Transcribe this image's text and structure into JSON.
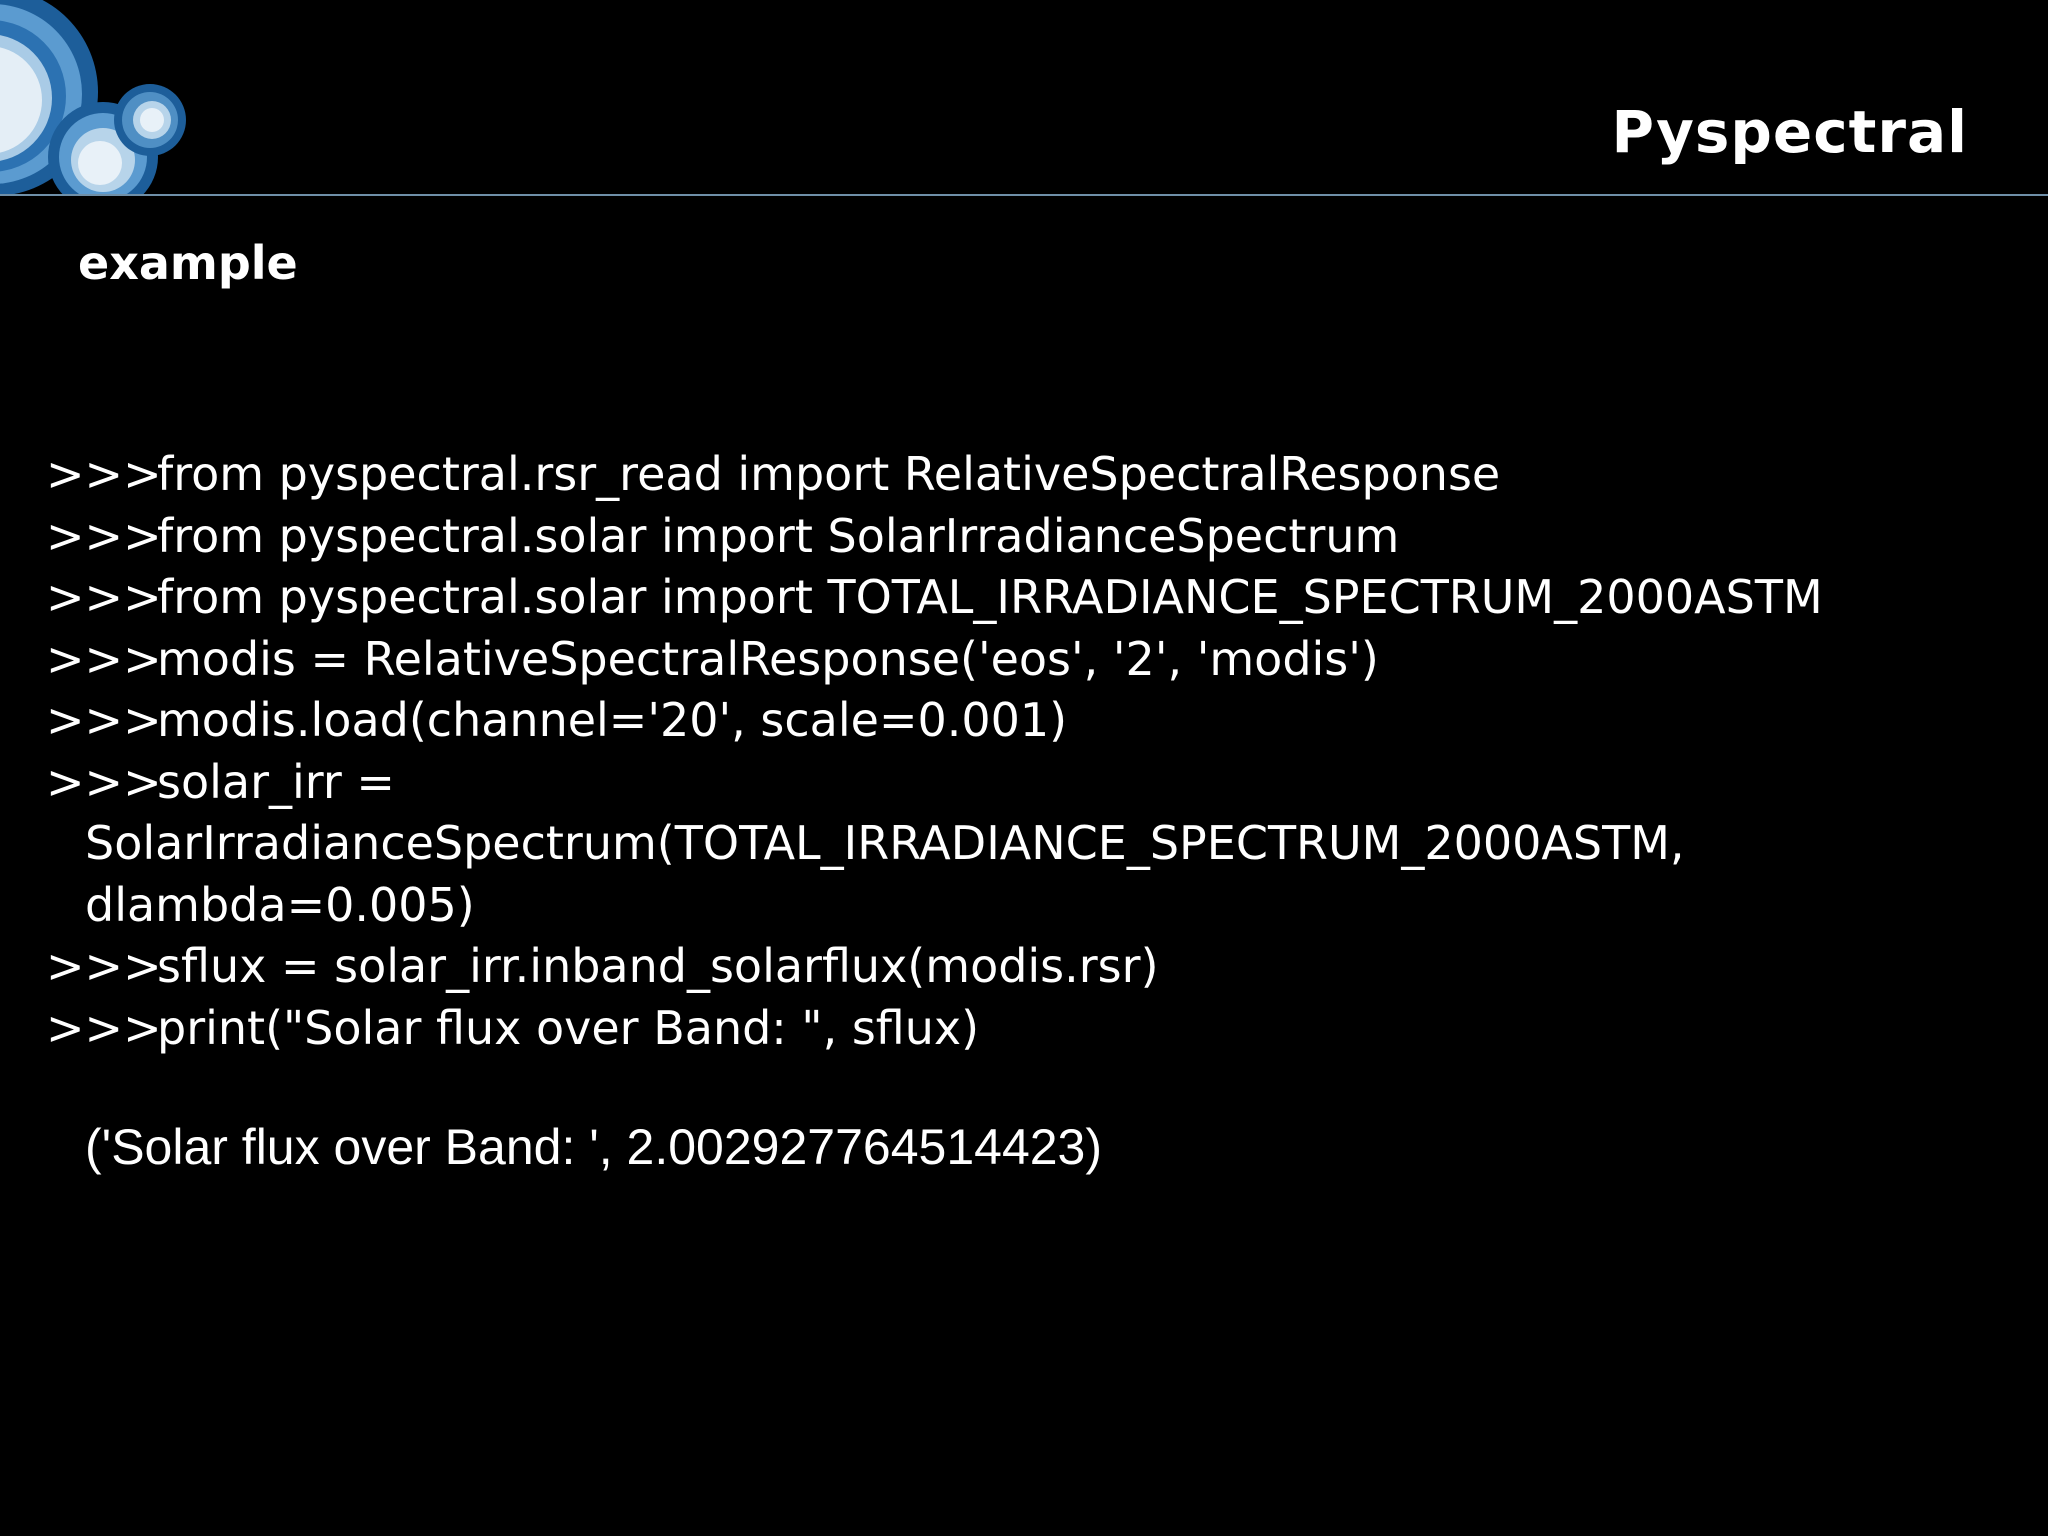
{
  "slide": {
    "title": "Pyspectral",
    "subtitle": "example",
    "prompt": ">>>",
    "code_lines": [
      {
        "prompt": true,
        "text": "from pyspectral.rsr_read import RelativeSpectralResponse"
      },
      {
        "prompt": true,
        "text": "from pyspectral.solar import SolarIrradianceSpectrum"
      },
      {
        "prompt": true,
        "text": "from pyspectral.solar import TOTAL_IRRADIANCE_SPECTRUM_2000ASTM"
      },
      {
        "prompt": true,
        "text": "modis = RelativeSpectralResponse('eos', '2', 'modis')"
      },
      {
        "prompt": true,
        "text": "modis.load(channel='20', scale=0.001)"
      },
      {
        "prompt": true,
        "text": "solar_irr ="
      },
      {
        "prompt": false,
        "text": "SolarIrradianceSpectrum(TOTAL_IRRADIANCE_SPECTRUM_2000ASTM,"
      },
      {
        "prompt": false,
        "text": "dlambda=0.005)"
      },
      {
        "prompt": true,
        "text": "sflux = solar_irr.inband_solarflux(modis.rsr)"
      },
      {
        "prompt": true,
        "text": "print(\"Solar flux over Band: \", sflux)"
      }
    ],
    "output": "('Solar flux over Band: ', 2.002927764514423)"
  },
  "colors": {
    "background": "#000000",
    "text": "#ffffff",
    "header_rule": "#6f8fa8",
    "logo_dark_blue": "#1d5e9a",
    "logo_mid_blue": "#4f8fc4",
    "logo_light": "#e4eef6"
  },
  "icons": {
    "logo": "concentric-circles-logo"
  }
}
